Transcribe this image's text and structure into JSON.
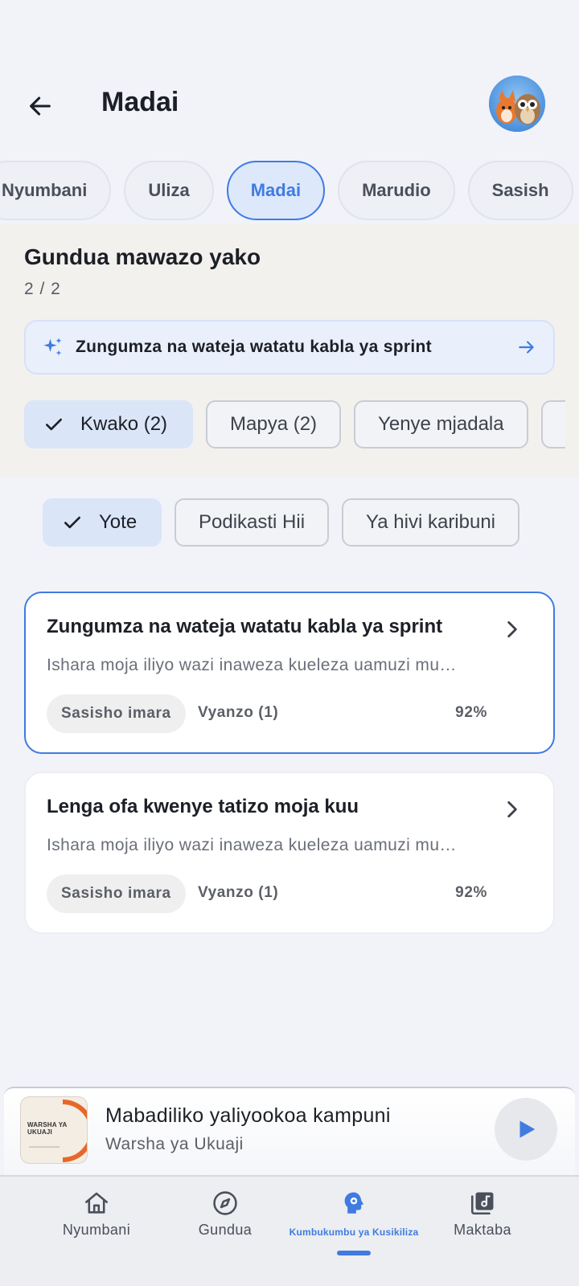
{
  "header": {
    "title": "Madai"
  },
  "tabs": [
    {
      "label": "Nyumbani"
    },
    {
      "label": "Uliza"
    },
    {
      "label": "Madai",
      "active": true
    },
    {
      "label": "Marudio"
    },
    {
      "label": "Sasish"
    }
  ],
  "discover": {
    "title": "Gundua mawazo yako",
    "counter": "2 / 2",
    "suggestion": "Zungumza na wateja watatu kabla ya sprint",
    "filters": [
      {
        "label": "Kwako (2)",
        "selected": true
      },
      {
        "label": "Mapya (2)"
      },
      {
        "label": "Yenye mjadala"
      }
    ]
  },
  "scope_filters": [
    {
      "label": "Yote",
      "selected": true
    },
    {
      "label": "Podikasti Hii"
    },
    {
      "label": "Ya hivi karibuni"
    }
  ],
  "cards": [
    {
      "title": "Zungumza na wateja watatu kabla ya sprint",
      "description": "Ishara moja iliyo wazi inaweza kueleza uamuzi mu…",
      "badge": "Sasisho imara",
      "sources": "Vyanzo (1)",
      "score": "92%",
      "active": true
    },
    {
      "title": "Lenga ofa kwenye tatizo moja kuu",
      "description": "Ishara moja iliyo wazi inaweza kueleza uamuzi mu…",
      "badge": "Sasisho imara",
      "sources": "Vyanzo (1)",
      "score": "92%"
    }
  ],
  "player": {
    "cover_text": "WARSHA YA UKUAJI",
    "title": "Mabadiliko yaliyookoa kampuni",
    "subtitle": "Warsha ya Ukuaji"
  },
  "bottom_nav": [
    {
      "label": "Nyumbani",
      "icon": "home-icon"
    },
    {
      "label": "Gundua",
      "icon": "compass-icon"
    },
    {
      "label": "Kumbukumbu ya Kusikiliza",
      "icon": "memory-icon",
      "active": true
    },
    {
      "label": "Maktaba",
      "icon": "library-icon"
    }
  ],
  "colors": {
    "accent": "#3f7be0",
    "background": "#f1f3f9",
    "discover_bg": "#f3f1ee"
  }
}
